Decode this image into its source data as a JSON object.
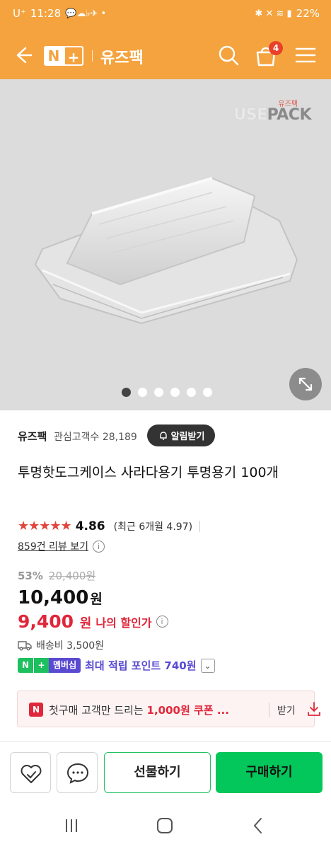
{
  "status_bar": {
    "carrier": "U⁺",
    "time": "11:28",
    "battery": "22%"
  },
  "header": {
    "logo_n": "N",
    "logo_plus": "+",
    "store_name": "유즈팩",
    "cart_count": "4",
    "icons": [
      "back-arrow-icon",
      "search-icon",
      "cart-icon",
      "menu-icon"
    ]
  },
  "gallery": {
    "watermark_small": "유즈팩",
    "watermark_use": "USE",
    "watermark_pack": "PACK",
    "slide_count": 6,
    "active_slide": 1
  },
  "product": {
    "seller": "유즈팩",
    "interest_label": "관심고객수 28,189",
    "alarm_label": "알림받기",
    "title": "투명핫도그케이스 사라다용기 투명용기 100개",
    "stars": "★★★★★",
    "rating": "4.86",
    "recent_rating": "(최근 6개월 4.97)",
    "review_link": "859건 리뷰 보기",
    "discount": "53%",
    "original_price": "20,400원",
    "price_number": "10,400",
    "price_unit": "원",
    "my_price_number": "9,400",
    "my_price_unit": "원",
    "my_discount_label": "나의 할인가",
    "shipping": "배송비 3,500원",
    "member_n": "N",
    "member_plus": "+",
    "member_label": "멤버십",
    "points": "최대 적립 포인트 740원"
  },
  "coupon": {
    "icon": "N",
    "text_before": "첫구매 고객만 드리는 ",
    "text_bold": "1,000원 쿠폰",
    "text_after": " ...",
    "get_label": "받기"
  },
  "actions": {
    "gift_label": "선물하기",
    "buy_label": "구매하기"
  },
  "colors": {
    "brand_orange": "#f4a33e",
    "naver_green": "#03c75a",
    "sale_red": "#e0263a",
    "membership_purple": "#5a4ad1"
  }
}
